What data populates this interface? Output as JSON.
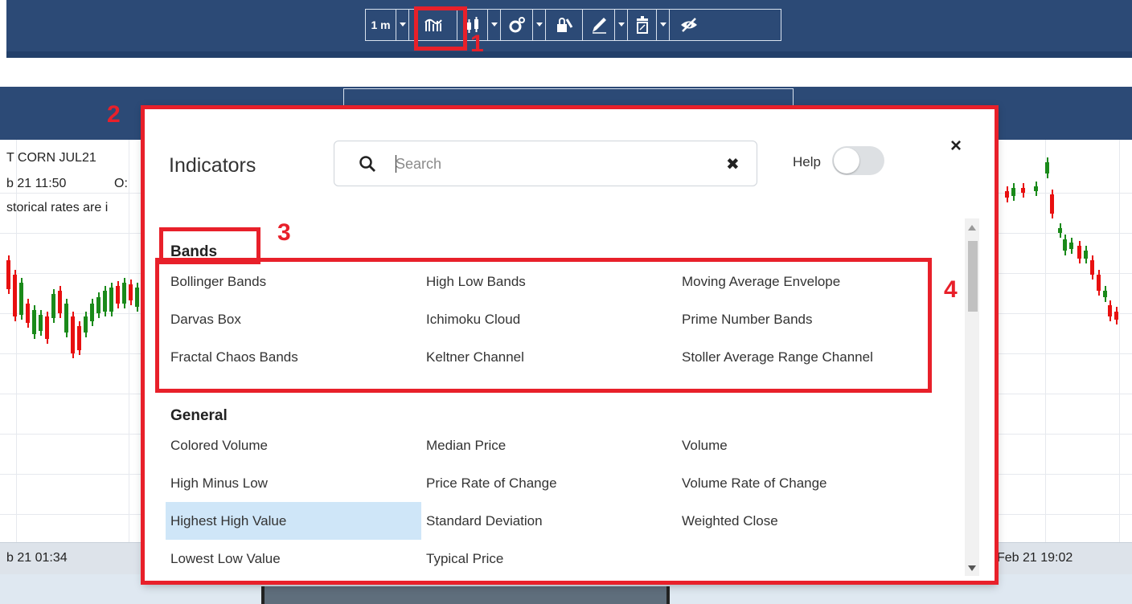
{
  "toolbar": {
    "timeframe_label": "1 m",
    "icons": [
      "indicators-icon",
      "candlestick-icon",
      "settings-icon",
      "lock-icon",
      "draw-pen-icon",
      "trash-icon",
      "hide-eye-icon"
    ]
  },
  "chart": {
    "instrument": "T CORN JUL21",
    "datetime": "b 21 11:50",
    "open_label": "O:",
    "note": "storical rates are i",
    "date_left": "b 21 01:34",
    "date_right": "Feb 21 19:02",
    "bull_color": "#1a8a1a",
    "bear_color": "#e81010"
  },
  "modal": {
    "title": "Indicators",
    "search_placeholder": "Search",
    "search_value": "",
    "help_label": "Help",
    "help_enabled": false,
    "close_glyph": "×",
    "clear_glyph": "✖",
    "sections": [
      {
        "name": "Bands",
        "items": [
          "Bollinger Bands",
          "High Low Bands",
          "Moving Average Envelope",
          "Darvas Box",
          "Ichimoku Cloud",
          "Prime Number Bands",
          "Fractal Chaos Bands",
          "Keltner Channel",
          "Stoller Average Range Channel"
        ]
      },
      {
        "name": "General",
        "items": [
          "Colored Volume",
          "Median Price",
          "Volume",
          "High Minus Low",
          "Price Rate of Change",
          "Volume Rate of Change",
          "Highest High Value",
          "Standard Deviation",
          "Weighted Close",
          "Lowest Low Value",
          "Typical Price"
        ]
      }
    ],
    "selected_item": "Highest High Value",
    "selection_color": "#cfe6f8"
  },
  "annotations": [
    "1",
    "2",
    "3",
    "4"
  ],
  "annotation_color": "#e8202a"
}
